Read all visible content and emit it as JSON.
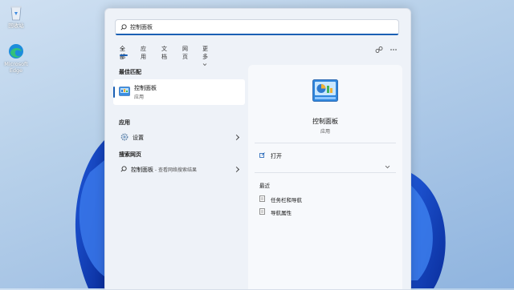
{
  "desktop": {
    "icons": [
      {
        "label": "回收站",
        "icon": "recycle-bin-icon"
      },
      {
        "label": "Microsoft Edge",
        "icon": "edge-icon"
      }
    ]
  },
  "search": {
    "query": "控制面板"
  },
  "tabs": [
    {
      "label": "全部",
      "active": true
    },
    {
      "label": "应用",
      "active": false
    },
    {
      "label": "文档",
      "active": false
    },
    {
      "label": "网页",
      "active": false
    },
    {
      "label": "更多",
      "active": false
    }
  ],
  "left": {
    "best_match_label": "最佳匹配",
    "best_match": {
      "title": "控制面板",
      "subtitle": "应用"
    },
    "apps_label": "应用",
    "apps": [
      {
        "title": "设置"
      }
    ],
    "web_label": "搜索网页",
    "web": {
      "title": "控制面板",
      "subtitle": " - 查看网络搜索结果"
    }
  },
  "right": {
    "title": "控制面板",
    "subtitle": "应用",
    "open_label": "打开",
    "recent_label": "最近",
    "recent": [
      {
        "label": "任务栏和导航"
      },
      {
        "label": "导航属性"
      }
    ]
  },
  "colors": {
    "accent": "#1a5fb4",
    "panel": "#eef2f8",
    "card": "#f7f9fc"
  }
}
